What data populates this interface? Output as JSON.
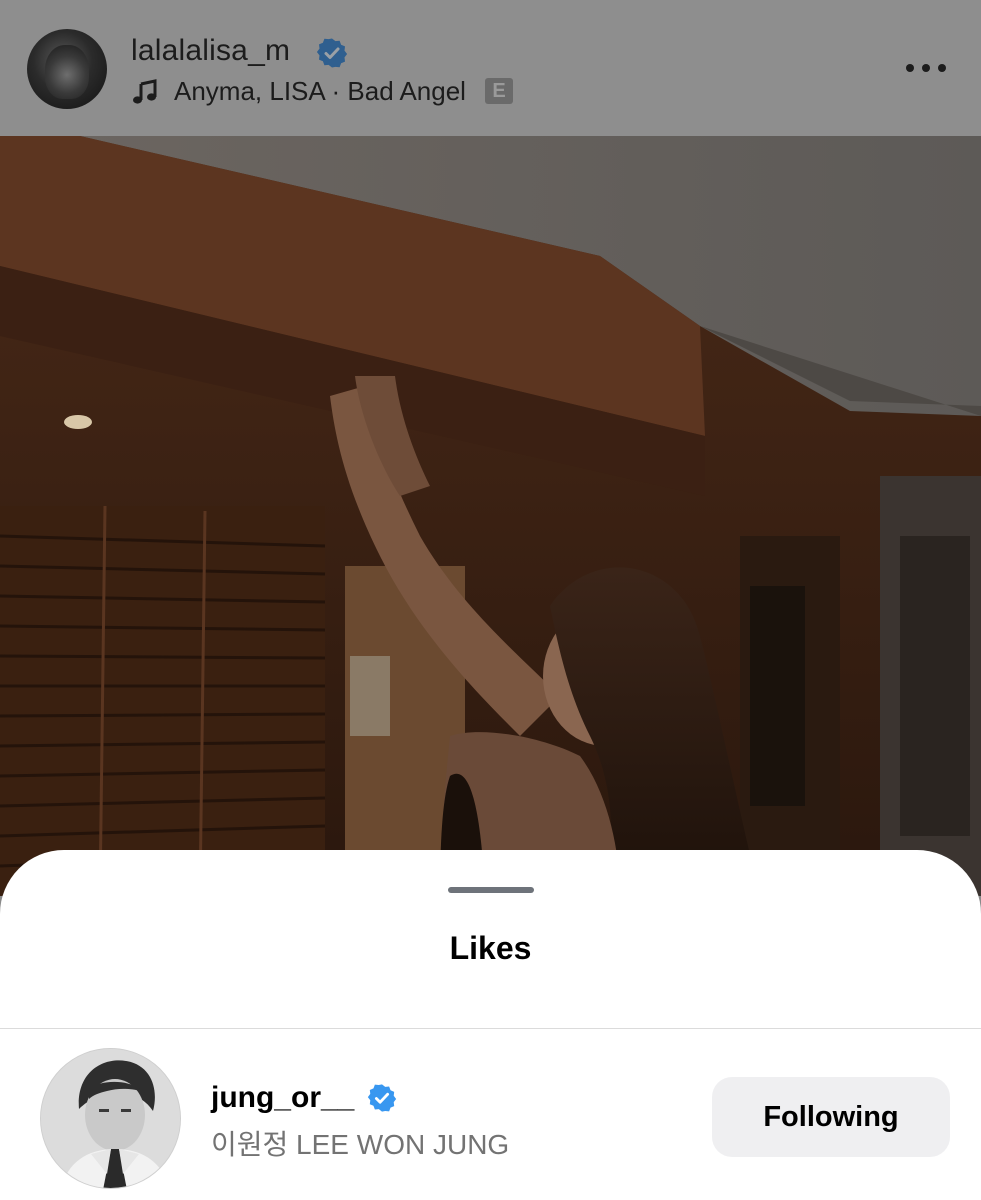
{
  "post": {
    "username": "lalalalisa_m",
    "music": "Anyma, LISA · Bad Angel",
    "explicit_badge": "E"
  },
  "sheet": {
    "title": "Likes"
  },
  "likes": [
    {
      "username": "jung_or__",
      "full_name": "이원정 LEE WON JUNG",
      "verified": true,
      "button_label": "Following"
    }
  ],
  "icons": {
    "verified": "verified-badge-icon",
    "music": "music-note-icon",
    "more": "more-options-icon"
  },
  "colors": {
    "verified_blue": "#3897f0",
    "button_bg": "#efeff1",
    "secondary_text": "#737373"
  }
}
